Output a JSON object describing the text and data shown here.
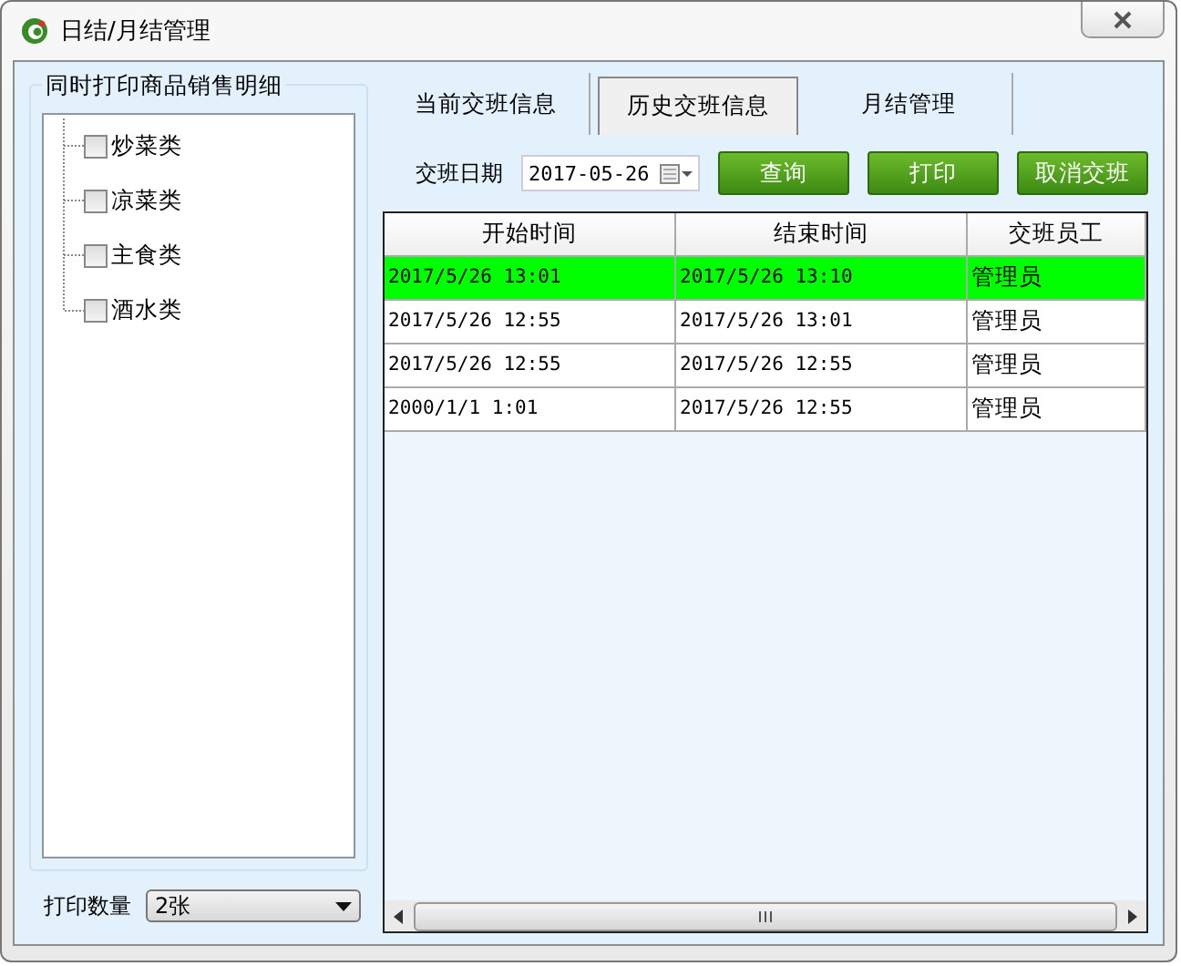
{
  "window": {
    "title": "日结/月结管理"
  },
  "left": {
    "group_title": "同时打印商品销售明细",
    "categories": [
      {
        "label": "炒菜类",
        "checked": false
      },
      {
        "label": "凉菜类",
        "checked": false
      },
      {
        "label": "主食类",
        "checked": false
      },
      {
        "label": "酒水类",
        "checked": false
      }
    ],
    "print_count": {
      "label": "打印数量",
      "value": "2张"
    }
  },
  "tabs": [
    {
      "label": "当前交班信息",
      "selected": false
    },
    {
      "label": "历史交班信息",
      "selected": true
    },
    {
      "label": "月结管理",
      "selected": false
    }
  ],
  "toolbar": {
    "date_label": "交班日期",
    "date_value": "2017-05-26",
    "buttons": [
      "查询",
      "打印",
      "取消交班"
    ]
  },
  "table": {
    "columns": [
      "开始时间",
      "结束时间",
      "交班员工"
    ],
    "rows": [
      {
        "cells": [
          "2017/5/26 13:01",
          "2017/5/26 13:10",
          "管理员"
        ],
        "selected": true
      },
      {
        "cells": [
          "2017/5/26 12:55",
          "2017/5/26 13:01",
          "管理员"
        ],
        "selected": false
      },
      {
        "cells": [
          "2017/5/26 12:55",
          "2017/5/26 12:55",
          "管理员"
        ],
        "selected": false
      },
      {
        "cells": [
          "2000/1/1 1:01",
          "2017/5/26 12:55",
          "管理员"
        ],
        "selected": false
      }
    ]
  }
}
